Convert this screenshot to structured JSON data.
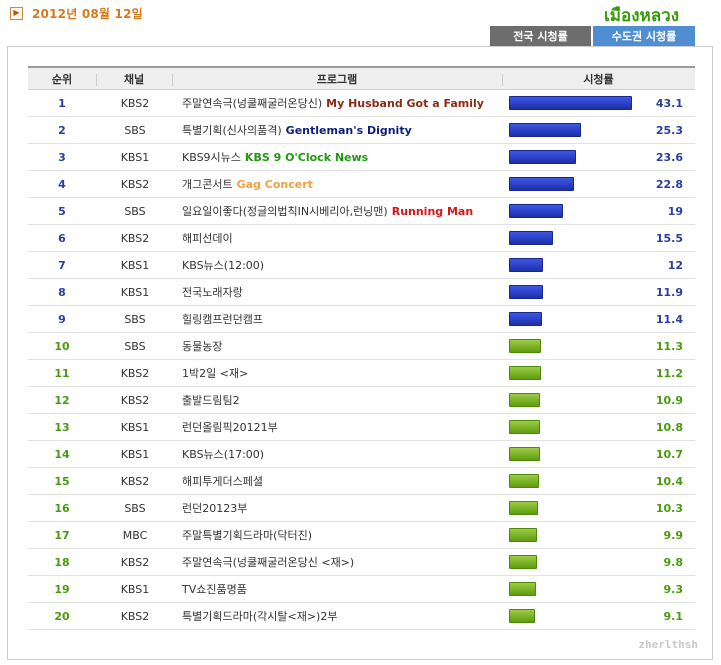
{
  "header": {
    "date_icon": "arrow-right-icon",
    "date": "2012년 08월 12일",
    "thai_title": "เมืองหลวง"
  },
  "tabs": [
    {
      "label": "전국 시청률",
      "active": false
    },
    {
      "label": "수도권 시청률",
      "active": true
    }
  ],
  "columns": {
    "rank": "순위",
    "channel": "채널",
    "program": "프로그램",
    "rating": "시청률"
  },
  "colors": {
    "blue_bar": "#2a3fc4",
    "green_bar": "#7cb52a",
    "blue_text": "#2b3f9e",
    "green_text": "#4a9a10",
    "ann_brown": "#8b2b12",
    "ann_navy": "#0f1f78",
    "ann_green": "#1f9a10",
    "ann_orange": "#f0a040",
    "ann_red": "#d81414"
  },
  "rows": [
    {
      "rank": "1",
      "channel": "KBS2",
      "program": "주말연속극(넝쿨째굴러온당신)",
      "annotation": "My Husband Got a Family",
      "ann_color": "#8b2b12",
      "rating": "43.1",
      "tier": "blue"
    },
    {
      "rank": "2",
      "channel": "SBS",
      "program": "특별기획(신사의품격)",
      "annotation": "Gentleman's Dignity",
      "ann_color": "#0f1f78",
      "rating": "25.3",
      "tier": "blue"
    },
    {
      "rank": "3",
      "channel": "KBS1",
      "program": "KBS9시뉴스",
      "annotation": "KBS 9 O'Clock News",
      "ann_color": "#1f9a10",
      "rating": "23.6",
      "tier": "blue"
    },
    {
      "rank": "4",
      "channel": "KBS2",
      "program": "개그콘서트",
      "annotation": "Gag Concert",
      "ann_color": "#f0a040",
      "rating": "22.8",
      "tier": "blue"
    },
    {
      "rank": "5",
      "channel": "SBS",
      "program": "일요일이좋다(정글의법칙IN시베리아,런닝맨)",
      "annotation": "Running Man",
      "ann_color": "#d81414",
      "rating": "19",
      "tier": "blue"
    },
    {
      "rank": "6",
      "channel": "KBS2",
      "program": "해피선데이",
      "annotation": "",
      "ann_color": "",
      "rating": "15.5",
      "tier": "blue"
    },
    {
      "rank": "7",
      "channel": "KBS1",
      "program": "KBS뉴스(12:00)",
      "annotation": "",
      "ann_color": "",
      "rating": "12",
      "tier": "blue"
    },
    {
      "rank": "8",
      "channel": "KBS1",
      "program": "전국노래자랑",
      "annotation": "",
      "ann_color": "",
      "rating": "11.9",
      "tier": "blue"
    },
    {
      "rank": "9",
      "channel": "SBS",
      "program": "힐링캠프런던캠프",
      "annotation": "",
      "ann_color": "",
      "rating": "11.4",
      "tier": "blue"
    },
    {
      "rank": "10",
      "channel": "SBS",
      "program": "동물농장",
      "annotation": "",
      "ann_color": "",
      "rating": "11.3",
      "tier": "green"
    },
    {
      "rank": "11",
      "channel": "KBS2",
      "program": "1박2일 <재>",
      "annotation": "",
      "ann_color": "",
      "rating": "11.2",
      "tier": "green"
    },
    {
      "rank": "12",
      "channel": "KBS2",
      "program": "출발드림팀2",
      "annotation": "",
      "ann_color": "",
      "rating": "10.9",
      "tier": "green"
    },
    {
      "rank": "13",
      "channel": "KBS1",
      "program": "런던올림픽20121부",
      "annotation": "",
      "ann_color": "",
      "rating": "10.8",
      "tier": "green"
    },
    {
      "rank": "14",
      "channel": "KBS1",
      "program": "KBS뉴스(17:00)",
      "annotation": "",
      "ann_color": "",
      "rating": "10.7",
      "tier": "green"
    },
    {
      "rank": "15",
      "channel": "KBS2",
      "program": "해피투게더스페셜",
      "annotation": "",
      "ann_color": "",
      "rating": "10.4",
      "tier": "green"
    },
    {
      "rank": "16",
      "channel": "SBS",
      "program": "런던20123부",
      "annotation": "",
      "ann_color": "",
      "rating": "10.3",
      "tier": "green"
    },
    {
      "rank": "17",
      "channel": "MBC",
      "program": "주말특별기획드라마(닥터진)",
      "annotation": "",
      "ann_color": "",
      "rating": "9.9",
      "tier": "green"
    },
    {
      "rank": "18",
      "channel": "KBS2",
      "program": "주말연속극(넝쿨째굴러온당신 <재>)",
      "annotation": "",
      "ann_color": "",
      "rating": "9.8",
      "tier": "green"
    },
    {
      "rank": "19",
      "channel": "KBS1",
      "program": "TV쇼진품명품",
      "annotation": "",
      "ann_color": "",
      "rating": "9.3",
      "tier": "green"
    },
    {
      "rank": "20",
      "channel": "KBS2",
      "program": "특별기획드라마(각시탈<재>)2부",
      "annotation": "",
      "ann_color": "",
      "rating": "9.1",
      "tier": "green"
    }
  ],
  "watermark": "zherlthsh"
}
